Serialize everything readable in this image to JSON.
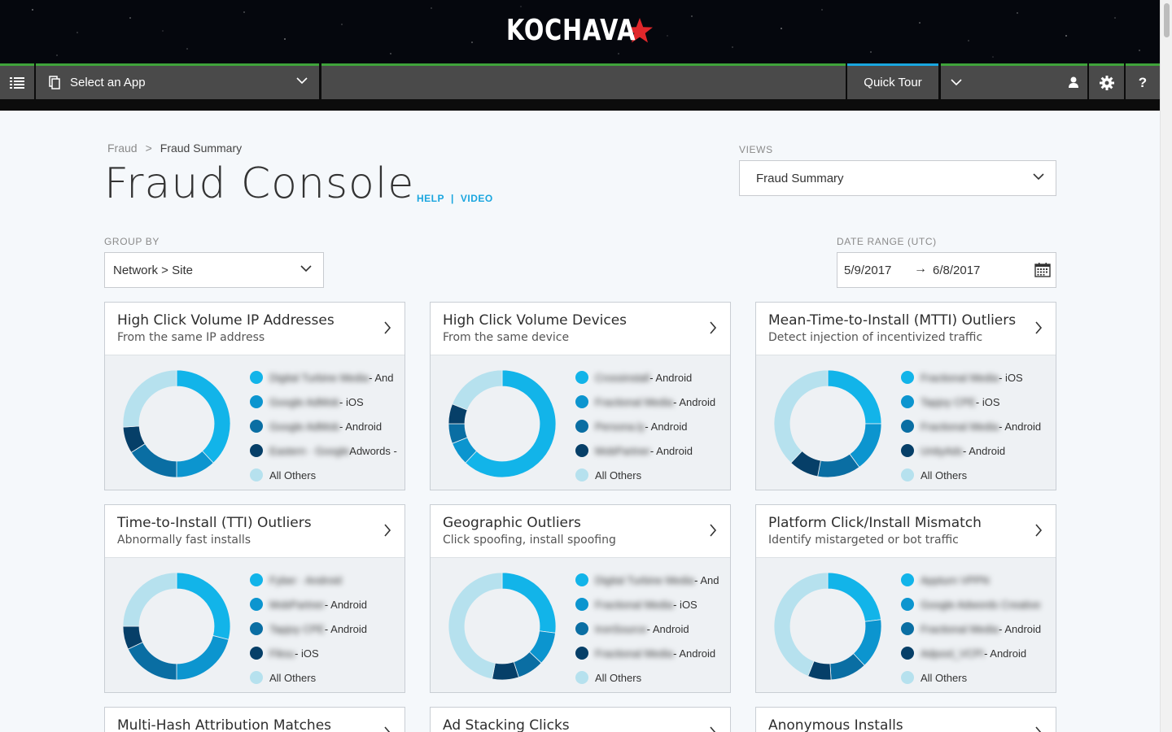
{
  "brand": {
    "logo_text": "KOCHAVA",
    "star_color": "#e0272b"
  },
  "navbar": {
    "app_select_label": "Select an App",
    "quick_tour_label": "Quick Tour",
    "help_label": "?"
  },
  "breadcrumb": {
    "parent": "Fraud",
    "separator": ">",
    "current": "Fraud Summary"
  },
  "page": {
    "title": "Fraud Console",
    "help_link": "HELP",
    "link_sep": "|",
    "video_link": "VIDEO"
  },
  "views": {
    "label": "VIEWS",
    "value": "Fraud Summary"
  },
  "group_by": {
    "label": "GROUP BY",
    "value": "Network > Site"
  },
  "date_range": {
    "label": "DATE RANGE (UTC)",
    "start": "5/9/2017",
    "arrow": "→",
    "end": "6/8/2017"
  },
  "legend_colors": [
    "#12b4e9",
    "#0c95cf",
    "#0a6ea3",
    "#063f68",
    "#b6e1ee"
  ],
  "cards": [
    {
      "title": "High Click Volume IP Addresses",
      "subtitle": "From the same IP address",
      "legend": [
        {
          "name": "Digital Turbine Media",
          "suffix": " - And"
        },
        {
          "name": "Google AdMob",
          "suffix": " - iOS"
        },
        {
          "name": "Google AdMob",
          "suffix": " - Android"
        },
        {
          "name": "Eastern · Google",
          "suffix": " Adwords -"
        },
        {
          "name": "",
          "suffix": "All Others"
        }
      ],
      "slices": [
        38,
        12,
        16,
        8,
        26
      ]
    },
    {
      "title": "High Click Volume Devices",
      "subtitle": "From the same device",
      "legend": [
        {
          "name": "Crossinstall",
          "suffix": " - Android"
        },
        {
          "name": "Fractional Media",
          "suffix": " - Android"
        },
        {
          "name": "Persona.ly",
          "suffix": " - Android"
        },
        {
          "name": "MobPartner",
          "suffix": " - Android"
        },
        {
          "name": "",
          "suffix": "All Others"
        }
      ],
      "slices": [
        62,
        7,
        6,
        6,
        19
      ]
    },
    {
      "title": "Mean-Time-to-Install (MTTI) Outliers",
      "subtitle": "Detect injection of incentivized traffic",
      "legend": [
        {
          "name": "Fractional Media",
          "suffix": " - iOS"
        },
        {
          "name": "Tapjoy CPE",
          "suffix": " - iOS"
        },
        {
          "name": "Fractional Media",
          "suffix": " - Android"
        },
        {
          "name": "UnityAds",
          "suffix": " - Android"
        },
        {
          "name": "",
          "suffix": "All Others"
        }
      ],
      "slices": [
        25,
        15,
        13,
        9,
        38
      ]
    },
    {
      "title": "Time-to-Install (TTI) Outliers",
      "subtitle": "Abnormally fast installs",
      "legend": [
        {
          "name": "Fyber · Android",
          "suffix": ""
        },
        {
          "name": "MobPartner",
          "suffix": " - Android"
        },
        {
          "name": "Tapjoy CPE",
          "suffix": " - Android"
        },
        {
          "name": "Fiksu",
          "suffix": " - iOS"
        },
        {
          "name": "",
          "suffix": "All Others"
        }
      ],
      "slices": [
        29,
        21,
        18,
        7,
        25
      ]
    },
    {
      "title": "Geographic Outliers",
      "subtitle": "Click spoofing, install spoofing",
      "legend": [
        {
          "name": "Digital Turbine Media",
          "suffix": " - And"
        },
        {
          "name": "Fractional Media",
          "suffix": " - iOS"
        },
        {
          "name": "IronSource",
          "suffix": " - Android"
        },
        {
          "name": "Fractional Media",
          "suffix": " - Android"
        },
        {
          "name": "",
          "suffix": "All Others"
        }
      ],
      "slices": [
        27,
        10,
        8,
        8,
        47
      ]
    },
    {
      "title": "Platform Click/Install Mismatch",
      "subtitle": "Identify mistargeted or bot traffic",
      "legend": [
        {
          "name": "Appturn VPPN",
          "suffix": ""
        },
        {
          "name": "Google Adwords Creative",
          "suffix": ""
        },
        {
          "name": "Fractional Media",
          "suffix": " - Android"
        },
        {
          "name": "Adpool_VCPI",
          "suffix": " - Android"
        },
        {
          "name": "",
          "suffix": "All Others"
        }
      ],
      "slices": [
        23,
        15,
        11,
        7,
        44
      ]
    }
  ],
  "peek_cards": [
    {
      "title": "Multi-Hash Attribution Matches"
    },
    {
      "title": "Ad Stacking Clicks"
    },
    {
      "title": "Anonymous Installs"
    }
  ]
}
